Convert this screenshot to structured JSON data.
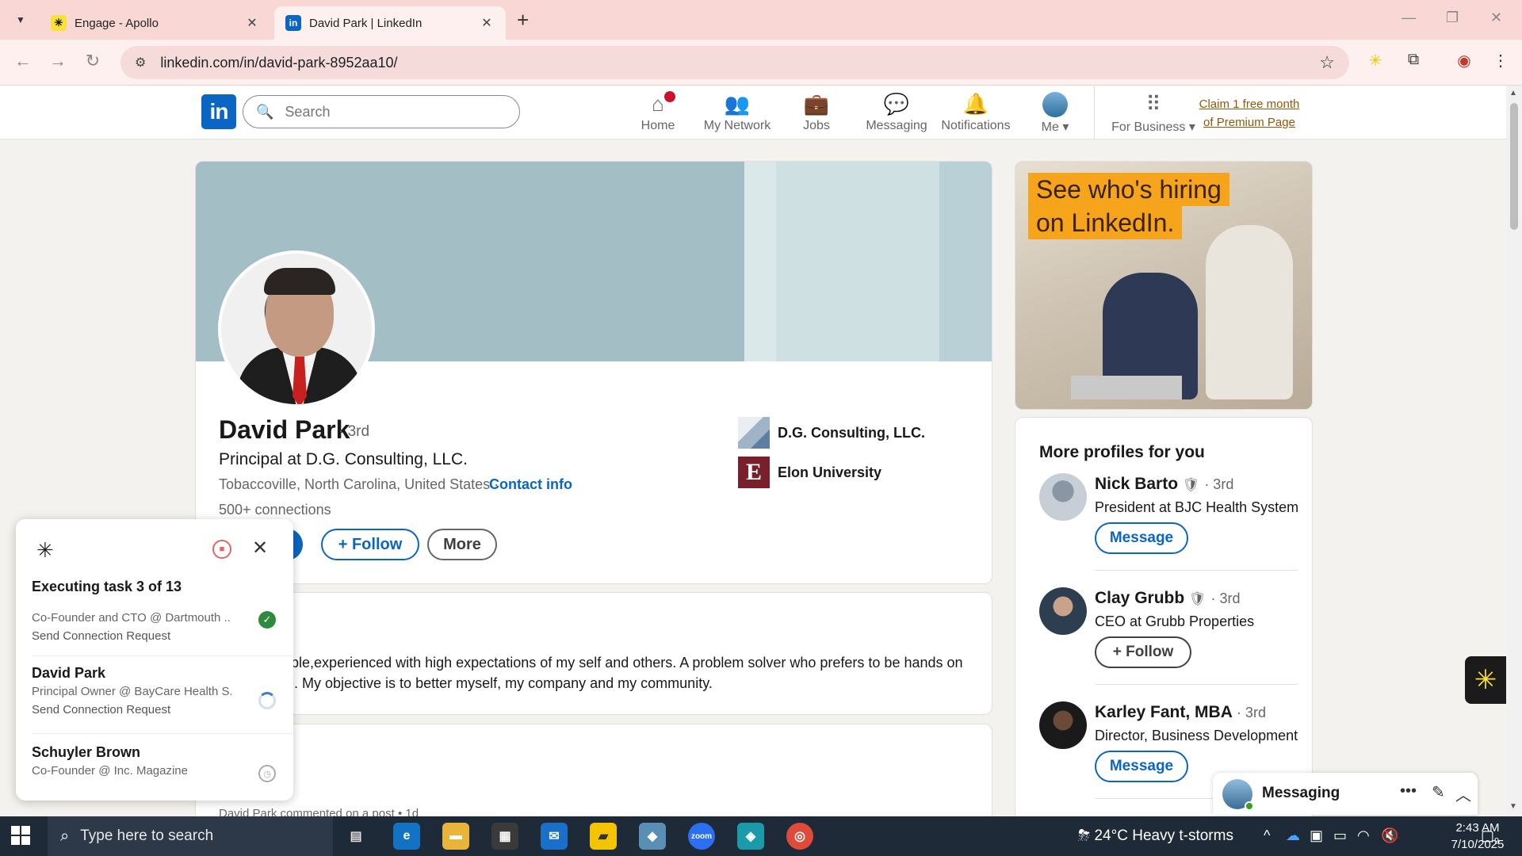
{
  "browser": {
    "tabs": [
      {
        "title": "Engage - Apollo",
        "favicon": "apollo-favicon",
        "active": false
      },
      {
        "title": "David Park | LinkedIn",
        "favicon": "linkedin-favicon",
        "active": true
      }
    ],
    "url": "linkedin.com/in/david-park-8952aa10/"
  },
  "header": {
    "search_placeholder": "Search",
    "nav": [
      {
        "label": "Home",
        "icon": "home-icon"
      },
      {
        "label": "My Network",
        "icon": "network-icon"
      },
      {
        "label": "Jobs",
        "icon": "briefcase-icon"
      },
      {
        "label": "Messaging",
        "icon": "chat-icon"
      },
      {
        "label": "Notifications",
        "icon": "bell-icon"
      },
      {
        "label": "Me",
        "icon": "avatar"
      },
      {
        "label": "For Business",
        "icon": "grid-icon"
      }
    ],
    "premium_line1": "Claim 1 free month",
    "premium_line2": "of Premium Page"
  },
  "profile": {
    "name": "David Park",
    "degree": "· 3rd",
    "headline": "Principal at D.G. Consulting, LLC.",
    "location": "Tobaccoville, North Carolina, United States ·",
    "contact_info": "Contact info",
    "connections": "500+ connections",
    "experience": [
      {
        "label": "D.G. Consulting, LLC."
      },
      {
        "label": "Elon University"
      }
    ],
    "buttons": {
      "primary": "e",
      "follow": "+ Follow",
      "more": "More"
    }
  },
  "about": {
    "text": "eople,experienced with high expectations of my self and others. A problem solver who prefers to be hands on ple. My objective is to better myself, my company and my community."
  },
  "activity": {
    "subtitle": "ers",
    "first_post": "David Park commented on a post • 1d"
  },
  "ad": {
    "line1": "See who's hiring",
    "line2": "on LinkedIn."
  },
  "more_profiles": {
    "title": "More profiles for you",
    "items": [
      {
        "name": "Nick Barto",
        "verified": "🛡",
        "degree": "· 3rd",
        "title": "President at BJC Health System",
        "button": "Message"
      },
      {
        "name": "Clay Grubb",
        "verified": "🛡",
        "degree": "· 3rd",
        "title": "CEO at Grubb Properties",
        "button": "+ Follow"
      },
      {
        "name": "Karley Fant, MBA",
        "verified": "",
        "degree": "· 3rd",
        "title": "Director, Business Development",
        "button": "Message"
      }
    ]
  },
  "messaging": {
    "label": "Messaging"
  },
  "apollo_panel": {
    "status": "Executing task 3 of 13",
    "tasks": [
      {
        "name": "",
        "subtitle": "Co-Founder and CTO @ Dartmouth ...",
        "action": "Send Connection Request",
        "state": "done"
      },
      {
        "name": "David Park",
        "subtitle": "Principal Owner @ BayCare Health S...",
        "action": "Send Connection Request",
        "state": "running"
      },
      {
        "name": "Schuyler Brown",
        "subtitle": "Co-Founder @ Inc. Magazine",
        "action": "",
        "state": "waiting"
      }
    ]
  },
  "taskbar": {
    "search_placeholder": "Type here to search",
    "weather": "24°C  Heavy t-storms",
    "time": "2:43 AM",
    "date": "7/10/2025",
    "notification_count": "9"
  }
}
